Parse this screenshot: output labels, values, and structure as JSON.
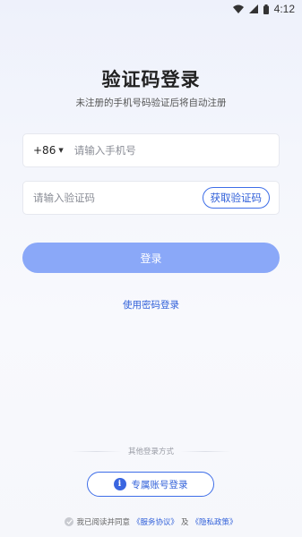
{
  "status_bar": {
    "time": "4:12",
    "icons": [
      "wifi-icon",
      "signal-icon",
      "battery-icon"
    ]
  },
  "header": {
    "title": "验证码登录",
    "subtitle": "未注册的手机号码验证后将自动注册"
  },
  "phone": {
    "country_code": "+86",
    "placeholder": "请输入手机号"
  },
  "code": {
    "placeholder": "请输入验证码",
    "get_code_label": "获取验证码"
  },
  "login_button": "登录",
  "password_login_link": "使用密码登录",
  "other_login": {
    "divider_text": "其他登录方式",
    "exclusive_account_label": "专属账号登录",
    "exclusive_icon": "info-icon"
  },
  "agreement": {
    "prefix": "我已阅读并同意",
    "service_link": "《服务协议》",
    "and": "及",
    "privacy_link": "《隐私政策》"
  },
  "colors": {
    "accent": "#2f5fd9",
    "login_button_bg": "#8aa8f8",
    "background": "#f4f6fc"
  }
}
